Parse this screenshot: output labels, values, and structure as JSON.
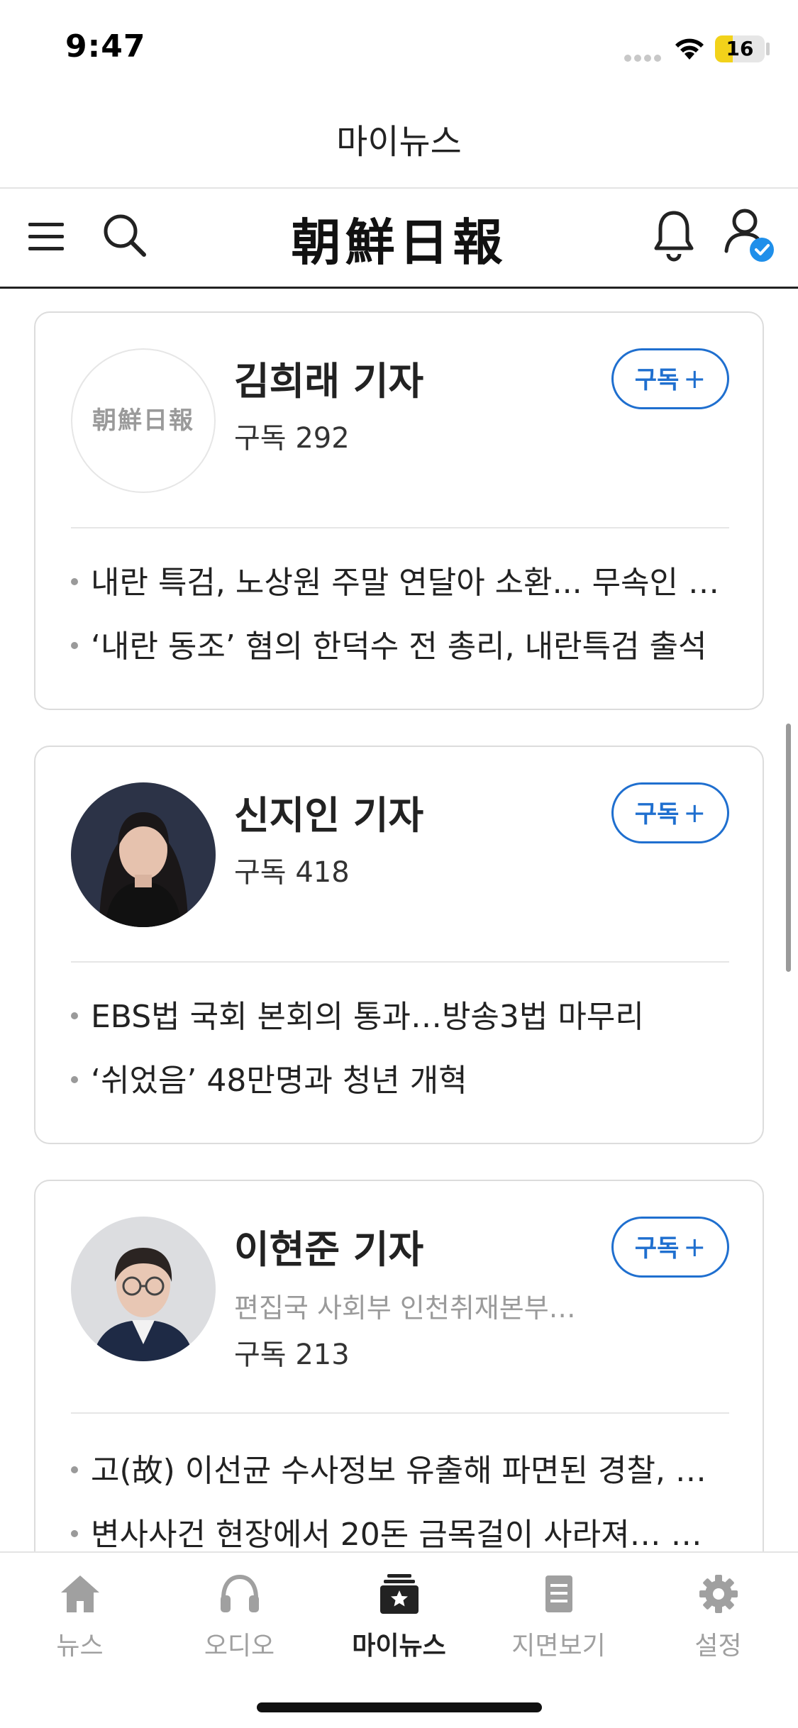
{
  "status_bar": {
    "time": "9:47",
    "battery": "16",
    "battery_level": 0.16
  },
  "page_title": "마이뉴스",
  "header": {
    "logo": "朝鮮日報"
  },
  "reporters": [
    {
      "name": "김희래 기자",
      "department": "",
      "avatar_logo": "朝鮮日報",
      "subscribers": "구독 292",
      "subscribe_label": "구독",
      "articles": [
        "내란 특검, 노상원 주말 연달아 소환... 무속인 …",
        "‘내란 동조’ 혐의 한덕수 전 총리, 내란특검 출석"
      ]
    },
    {
      "name": "신지인 기자",
      "department": "",
      "subscribers": "구독 418",
      "subscribe_label": "구독",
      "articles": [
        "EBS법 국회 본회의 통과…방송3법 마무리",
        "‘쉬었음’ 48만명과 청년 개혁"
      ]
    },
    {
      "name": "이현준 기자",
      "department": "편집국 사회부 인천취재본부…",
      "subscribers": "구독 213",
      "subscribe_label": "구독",
      "articles": [
        "고(故) 이선균 수사정보 유출해 파면된 경찰, …",
        "변사사건 현장에서 20돈 금목걸이 사라져… …"
      ]
    }
  ],
  "tabs": [
    {
      "label": "뉴스",
      "icon": "home-icon"
    },
    {
      "label": "오디오",
      "icon": "headphones-icon"
    },
    {
      "label": "마이뉴스",
      "icon": "star-box-icon",
      "active": true
    },
    {
      "label": "지면보기",
      "icon": "document-icon"
    },
    {
      "label": "설정",
      "icon": "gear-icon"
    }
  ],
  "colors": {
    "accent": "#1f6fcf",
    "inactive": "#a0a0a0",
    "text": "#222222"
  }
}
